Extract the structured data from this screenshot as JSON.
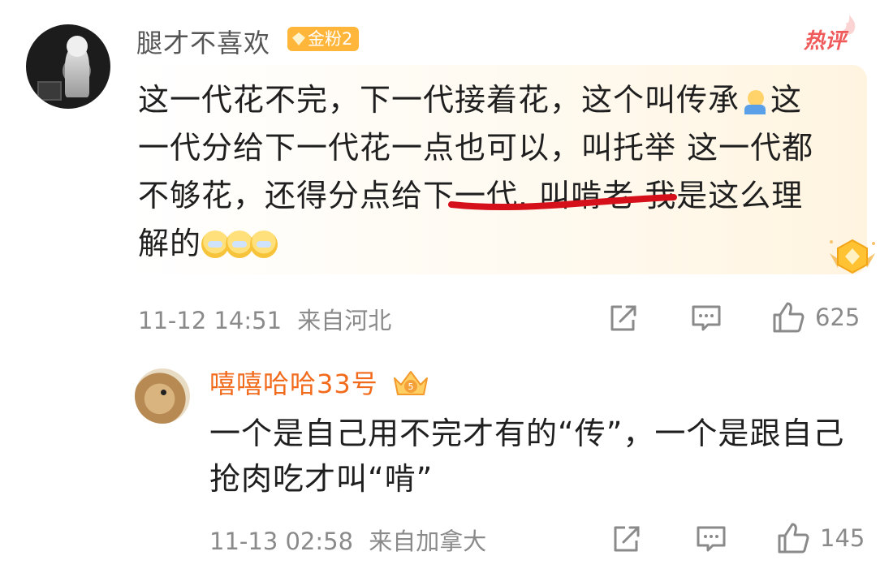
{
  "comment": {
    "username": "腿才不喜欢",
    "badge": "金粉2",
    "hot_tag": "热评",
    "body_lines": [
      "这一代花不完，下一代接着花，这个叫传承",
      "这",
      "一代分给下一代花一点也可以，叫托举 这一代都",
      "不够花，还得分点给下一代. 叫啃老 我是这么理",
      "解的"
    ],
    "timestamp": "11-12 14:51",
    "location": "来自河北",
    "likes": "625",
    "icons": [
      "share-icon",
      "comment-icon",
      "like-icon",
      "medal-icon",
      "emoji-icon"
    ],
    "accent": "#f05a5a"
  },
  "reply": {
    "username": "嘻嘻哈哈33号",
    "body_lines": [
      "一个是自己用不完才有的“传”，一个是跟自己",
      "抢肉吃才叫“啃”"
    ],
    "timestamp": "11-13 02:58",
    "location": "来自加拿大",
    "likes": "145",
    "username_color": "#f26a1b"
  }
}
